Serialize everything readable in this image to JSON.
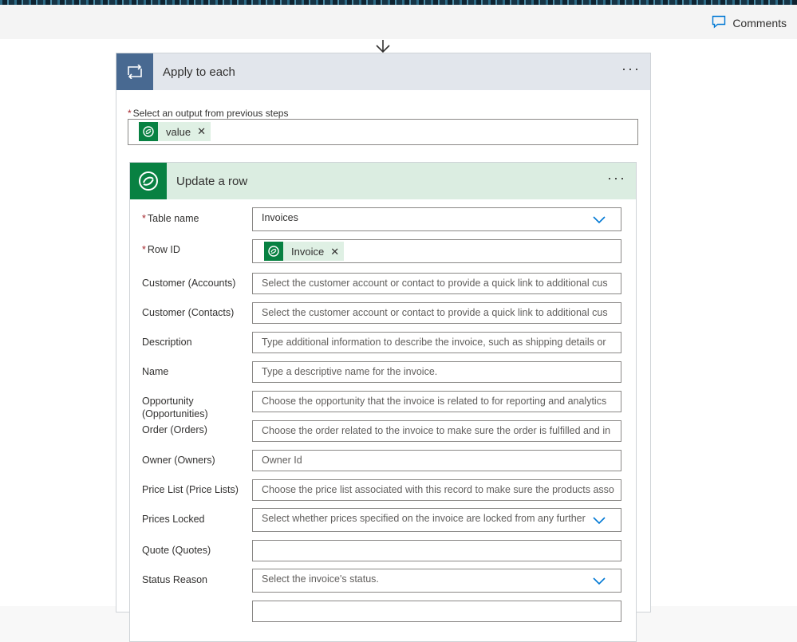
{
  "topbar": {
    "comments_label": "Comments",
    "comments_icon": "comment-icon"
  },
  "apply": {
    "title": "Apply to each",
    "icon": "loop-icon",
    "menu_label": "···",
    "select_label": "Select an output from previous steps",
    "select_token": "value"
  },
  "update": {
    "title": "Update a row",
    "icon": "dataverse-icon",
    "menu_label": "···",
    "fields": {
      "table_name": {
        "label": "Table name",
        "value": "Invoices"
      },
      "row_id": {
        "label": "Row ID",
        "token": "Invoice"
      },
      "customer_accounts": {
        "label": "Customer (Accounts)",
        "placeholder": "Select the customer account or contact to provide a quick link to additional cus"
      },
      "customer_contacts": {
        "label": "Customer (Contacts)",
        "placeholder": "Select the customer account or contact to provide a quick link to additional cus"
      },
      "description": {
        "label": "Description",
        "placeholder": "Type additional information to describe the invoice, such as shipping details or"
      },
      "name": {
        "label": "Name",
        "placeholder": "Type a descriptive name for the invoice."
      },
      "opportunity": {
        "label": "Opportunity (Opportunities)",
        "placeholder": "Choose the opportunity that the invoice is related to for reporting and analytics"
      },
      "order": {
        "label": "Order (Orders)",
        "placeholder": "Choose the order related to the invoice to make sure the order is fulfilled and in"
      },
      "owner": {
        "label": "Owner (Owners)",
        "placeholder": "Owner Id"
      },
      "price_list": {
        "label": "Price List (Price Lists)",
        "placeholder": "Choose the price list associated with this record to make sure the products asso"
      },
      "prices_locked": {
        "label": "Prices Locked",
        "placeholder": "Select whether prices specified on the invoice are locked from any further"
      },
      "quote": {
        "label": "Quote (Quotes)",
        "placeholder": ""
      },
      "status_reason": {
        "label": "Status Reason",
        "placeholder": "Select the invoice's status."
      }
    }
  },
  "colors": {
    "loop_accent": "#486991",
    "dataverse_green": "#088142",
    "chevron_blue": "#0078d4",
    "required_red": "#a4262c"
  }
}
